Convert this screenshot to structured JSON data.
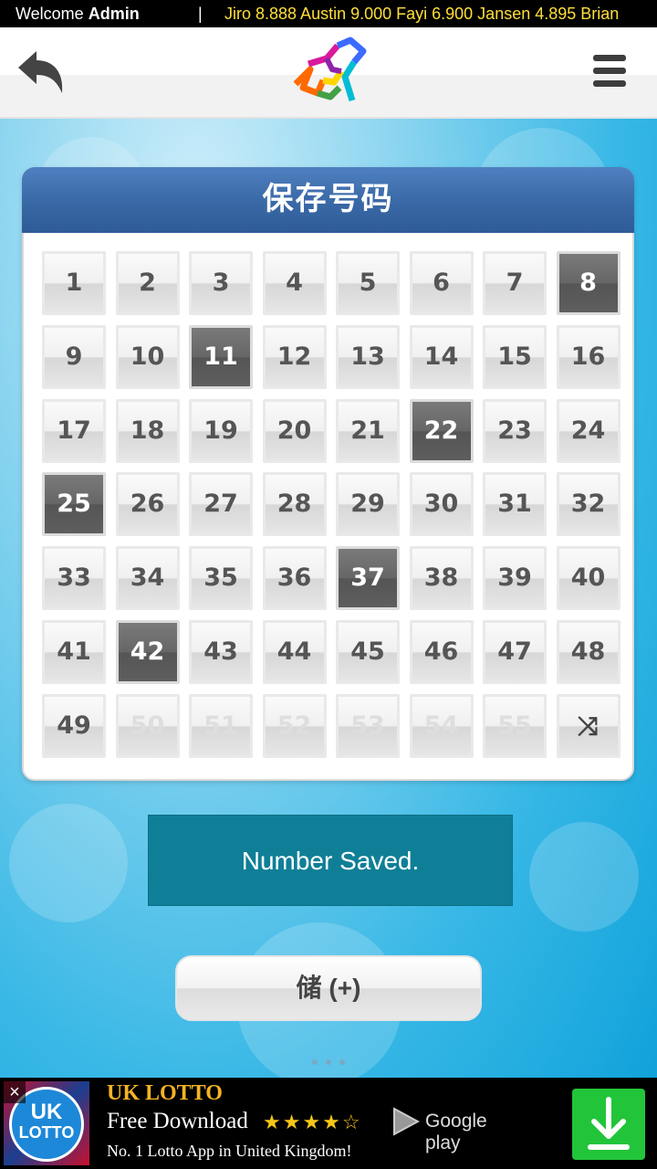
{
  "ticker": {
    "welcome_prefix": "Welcome",
    "welcome_user": "Admin",
    "separator": "|",
    "scores": "Jiro 8.888  Austin 9.000  Fayi 6.900  Jansen 4.895  Brian"
  },
  "header": {
    "back_icon": "back-arrow-icon",
    "logo_icon": "colorful-star-logo",
    "menu_icon": "hamburger-menu-icon"
  },
  "panel": {
    "title": "保存号码",
    "numbers": [
      {
        "n": "1",
        "state": "normal"
      },
      {
        "n": "2",
        "state": "normal"
      },
      {
        "n": "3",
        "state": "normal"
      },
      {
        "n": "4",
        "state": "normal"
      },
      {
        "n": "5",
        "state": "normal"
      },
      {
        "n": "6",
        "state": "normal"
      },
      {
        "n": "7",
        "state": "normal"
      },
      {
        "n": "8",
        "state": "selected"
      },
      {
        "n": "9",
        "state": "normal"
      },
      {
        "n": "10",
        "state": "normal"
      },
      {
        "n": "11",
        "state": "selected"
      },
      {
        "n": "12",
        "state": "normal"
      },
      {
        "n": "13",
        "state": "normal"
      },
      {
        "n": "14",
        "state": "normal"
      },
      {
        "n": "15",
        "state": "normal"
      },
      {
        "n": "16",
        "state": "normal"
      },
      {
        "n": "17",
        "state": "normal"
      },
      {
        "n": "18",
        "state": "normal"
      },
      {
        "n": "19",
        "state": "normal"
      },
      {
        "n": "20",
        "state": "normal"
      },
      {
        "n": "21",
        "state": "normal"
      },
      {
        "n": "22",
        "state": "selected"
      },
      {
        "n": "23",
        "state": "normal"
      },
      {
        "n": "24",
        "state": "normal"
      },
      {
        "n": "25",
        "state": "selected"
      },
      {
        "n": "26",
        "state": "normal"
      },
      {
        "n": "27",
        "state": "normal"
      },
      {
        "n": "28",
        "state": "normal"
      },
      {
        "n": "29",
        "state": "normal"
      },
      {
        "n": "30",
        "state": "normal"
      },
      {
        "n": "31",
        "state": "normal"
      },
      {
        "n": "32",
        "state": "normal"
      },
      {
        "n": "33",
        "state": "normal"
      },
      {
        "n": "34",
        "state": "normal"
      },
      {
        "n": "35",
        "state": "normal"
      },
      {
        "n": "36",
        "state": "normal"
      },
      {
        "n": "37",
        "state": "selected"
      },
      {
        "n": "38",
        "state": "normal"
      },
      {
        "n": "39",
        "state": "normal"
      },
      {
        "n": "40",
        "state": "normal"
      },
      {
        "n": "41",
        "state": "normal"
      },
      {
        "n": "42",
        "state": "selected"
      },
      {
        "n": "43",
        "state": "normal"
      },
      {
        "n": "44",
        "state": "normal"
      },
      {
        "n": "45",
        "state": "normal"
      },
      {
        "n": "46",
        "state": "normal"
      },
      {
        "n": "47",
        "state": "normal"
      },
      {
        "n": "48",
        "state": "normal"
      },
      {
        "n": "49",
        "state": "normal"
      },
      {
        "n": "50",
        "state": "disabled"
      },
      {
        "n": "51",
        "state": "disabled"
      },
      {
        "n": "52",
        "state": "disabled"
      },
      {
        "n": "53",
        "state": "disabled"
      },
      {
        "n": "54",
        "state": "disabled"
      },
      {
        "n": "55",
        "state": "disabled"
      },
      {
        "n": "⤨",
        "state": "shuffle"
      }
    ]
  },
  "toast": {
    "message": "Number Saved."
  },
  "store_button": {
    "label": "储 (+)"
  },
  "ad": {
    "close": "×",
    "logo_line1": "UK",
    "logo_line2": "LOTTO",
    "title": "UK LOTTO",
    "free": "Free Download",
    "stars": "★★★★☆",
    "store": "Google play",
    "subtitle": "No. 1 Lotto App in United Kingdom!",
    "download_icon": "download-icon"
  },
  "colors": {
    "header_blue": "#3b6aa8",
    "selected_cell": "#5e5e5e",
    "toast_bg": "#0f7f97",
    "ad_title": "#f5b324",
    "ad_download": "#22c53a",
    "ticker_scores": "#ffdf3a"
  }
}
